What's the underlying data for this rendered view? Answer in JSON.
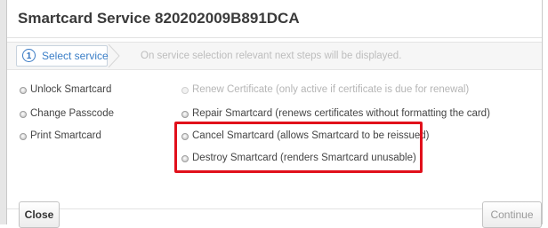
{
  "dialog": {
    "title": "Smartcard Service 820202009B891DCA"
  },
  "steps": {
    "active_number": "1",
    "active_label": "Select service",
    "hint": "On service selection relevant next steps will be displayed."
  },
  "options": {
    "left": [
      {
        "label": "Unlock Smartcard",
        "enabled": true
      },
      {
        "label": "Change Passcode",
        "enabled": true
      },
      {
        "label": "Print Smartcard",
        "enabled": true
      }
    ],
    "right": [
      {
        "label": "Renew Certificate (only active if certificate is due for renewal)",
        "enabled": false
      },
      {
        "label": "Repair Smartcard (renews certificates without formatting the card)",
        "enabled": true
      },
      {
        "label": "Cancel Smartcard (allows Smartcard to be reissued)",
        "enabled": true
      },
      {
        "label": "Destroy Smartcard (renders Smartcard unusable)",
        "enabled": true
      }
    ]
  },
  "footer": {
    "close_label": "Close",
    "continue_label": "Continue"
  },
  "colors": {
    "highlight": "#e1101b",
    "accent": "#3a7ec7"
  }
}
